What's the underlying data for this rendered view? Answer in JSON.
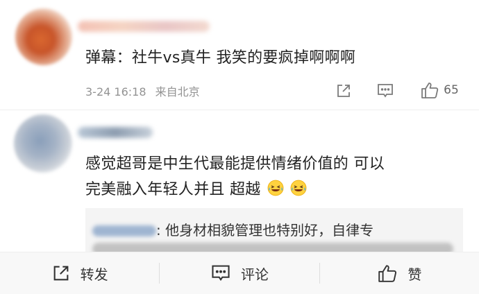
{
  "comments": [
    {
      "text": "弹幕：社牛vs真牛 我笑的要疯掉啊啊啊",
      "time": "3-24 16:18",
      "location": "来自北京",
      "likes": "65"
    },
    {
      "text_line1": "感觉超哥是中生代最能提供情绪价值的 可以",
      "text_line2": "完美融入年轻人并且 超越",
      "emoji": [
        "laughing-crying",
        "laughing-crying"
      ],
      "reply": {
        "text": ": 他身材相貌管理也特别好，自律专"
      }
    }
  ],
  "bottom_bar": {
    "repost": "转发",
    "comment": "评论",
    "like": "赞"
  },
  "colors": {
    "meta": "#939393",
    "reply_bg": "#f4f4f4",
    "bar_bg": "#f8f8f8"
  }
}
